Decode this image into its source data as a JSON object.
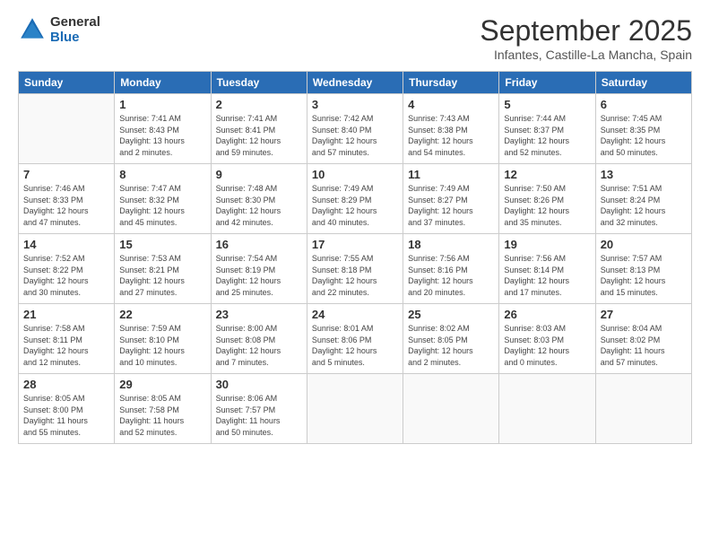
{
  "header": {
    "logo_line1": "General",
    "logo_line2": "Blue",
    "month": "September 2025",
    "location": "Infantes, Castille-La Mancha, Spain"
  },
  "weekdays": [
    "Sunday",
    "Monday",
    "Tuesday",
    "Wednesday",
    "Thursday",
    "Friday",
    "Saturday"
  ],
  "weeks": [
    [
      {
        "day": "",
        "info": ""
      },
      {
        "day": "1",
        "info": "Sunrise: 7:41 AM\nSunset: 8:43 PM\nDaylight: 13 hours\nand 2 minutes."
      },
      {
        "day": "2",
        "info": "Sunrise: 7:41 AM\nSunset: 8:41 PM\nDaylight: 12 hours\nand 59 minutes."
      },
      {
        "day": "3",
        "info": "Sunrise: 7:42 AM\nSunset: 8:40 PM\nDaylight: 12 hours\nand 57 minutes."
      },
      {
        "day": "4",
        "info": "Sunrise: 7:43 AM\nSunset: 8:38 PM\nDaylight: 12 hours\nand 54 minutes."
      },
      {
        "day": "5",
        "info": "Sunrise: 7:44 AM\nSunset: 8:37 PM\nDaylight: 12 hours\nand 52 minutes."
      },
      {
        "day": "6",
        "info": "Sunrise: 7:45 AM\nSunset: 8:35 PM\nDaylight: 12 hours\nand 50 minutes."
      }
    ],
    [
      {
        "day": "7",
        "info": "Sunrise: 7:46 AM\nSunset: 8:33 PM\nDaylight: 12 hours\nand 47 minutes."
      },
      {
        "day": "8",
        "info": "Sunrise: 7:47 AM\nSunset: 8:32 PM\nDaylight: 12 hours\nand 45 minutes."
      },
      {
        "day": "9",
        "info": "Sunrise: 7:48 AM\nSunset: 8:30 PM\nDaylight: 12 hours\nand 42 minutes."
      },
      {
        "day": "10",
        "info": "Sunrise: 7:49 AM\nSunset: 8:29 PM\nDaylight: 12 hours\nand 40 minutes."
      },
      {
        "day": "11",
        "info": "Sunrise: 7:49 AM\nSunset: 8:27 PM\nDaylight: 12 hours\nand 37 minutes."
      },
      {
        "day": "12",
        "info": "Sunrise: 7:50 AM\nSunset: 8:26 PM\nDaylight: 12 hours\nand 35 minutes."
      },
      {
        "day": "13",
        "info": "Sunrise: 7:51 AM\nSunset: 8:24 PM\nDaylight: 12 hours\nand 32 minutes."
      }
    ],
    [
      {
        "day": "14",
        "info": "Sunrise: 7:52 AM\nSunset: 8:22 PM\nDaylight: 12 hours\nand 30 minutes."
      },
      {
        "day": "15",
        "info": "Sunrise: 7:53 AM\nSunset: 8:21 PM\nDaylight: 12 hours\nand 27 minutes."
      },
      {
        "day": "16",
        "info": "Sunrise: 7:54 AM\nSunset: 8:19 PM\nDaylight: 12 hours\nand 25 minutes."
      },
      {
        "day": "17",
        "info": "Sunrise: 7:55 AM\nSunset: 8:18 PM\nDaylight: 12 hours\nand 22 minutes."
      },
      {
        "day": "18",
        "info": "Sunrise: 7:56 AM\nSunset: 8:16 PM\nDaylight: 12 hours\nand 20 minutes."
      },
      {
        "day": "19",
        "info": "Sunrise: 7:56 AM\nSunset: 8:14 PM\nDaylight: 12 hours\nand 17 minutes."
      },
      {
        "day": "20",
        "info": "Sunrise: 7:57 AM\nSunset: 8:13 PM\nDaylight: 12 hours\nand 15 minutes."
      }
    ],
    [
      {
        "day": "21",
        "info": "Sunrise: 7:58 AM\nSunset: 8:11 PM\nDaylight: 12 hours\nand 12 minutes."
      },
      {
        "day": "22",
        "info": "Sunrise: 7:59 AM\nSunset: 8:10 PM\nDaylight: 12 hours\nand 10 minutes."
      },
      {
        "day": "23",
        "info": "Sunrise: 8:00 AM\nSunset: 8:08 PM\nDaylight: 12 hours\nand 7 minutes."
      },
      {
        "day": "24",
        "info": "Sunrise: 8:01 AM\nSunset: 8:06 PM\nDaylight: 12 hours\nand 5 minutes."
      },
      {
        "day": "25",
        "info": "Sunrise: 8:02 AM\nSunset: 8:05 PM\nDaylight: 12 hours\nand 2 minutes."
      },
      {
        "day": "26",
        "info": "Sunrise: 8:03 AM\nSunset: 8:03 PM\nDaylight: 12 hours\nand 0 minutes."
      },
      {
        "day": "27",
        "info": "Sunrise: 8:04 AM\nSunset: 8:02 PM\nDaylight: 11 hours\nand 57 minutes."
      }
    ],
    [
      {
        "day": "28",
        "info": "Sunrise: 8:05 AM\nSunset: 8:00 PM\nDaylight: 11 hours\nand 55 minutes."
      },
      {
        "day": "29",
        "info": "Sunrise: 8:05 AM\nSunset: 7:58 PM\nDaylight: 11 hours\nand 52 minutes."
      },
      {
        "day": "30",
        "info": "Sunrise: 8:06 AM\nSunset: 7:57 PM\nDaylight: 11 hours\nand 50 minutes."
      },
      {
        "day": "",
        "info": ""
      },
      {
        "day": "",
        "info": ""
      },
      {
        "day": "",
        "info": ""
      },
      {
        "day": "",
        "info": ""
      }
    ]
  ]
}
